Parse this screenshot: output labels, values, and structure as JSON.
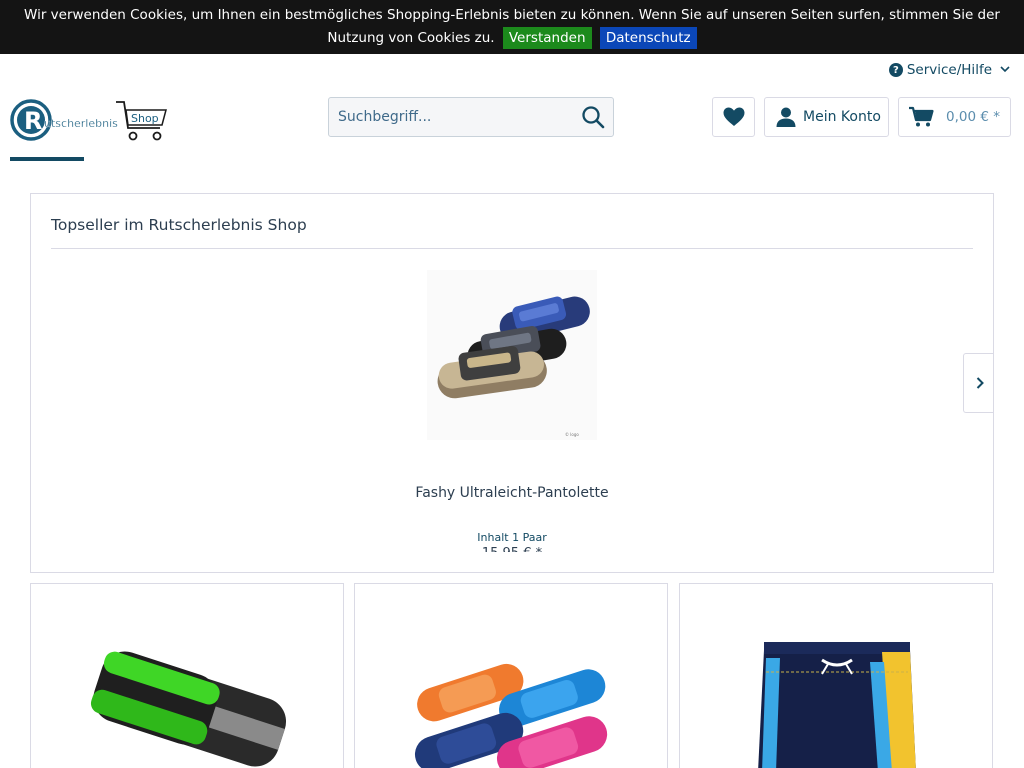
{
  "cookie_bar": {
    "message": "Wir verwenden Cookies, um Ihnen ein bestmögliches Shopping-Erlebnis bieten zu können. Wenn Sie auf unseren Seiten surfen, stimmen Sie der Nutzung von Cookies zu.",
    "accept_label": "Verstanden",
    "privacy_label": "Datenschutz",
    "accept_color": "#1c8a1c",
    "privacy_color": "#0b47b8"
  },
  "header": {
    "service_label": "Service/Hilfe",
    "logo_letter": "R",
    "logo_text": "utscherlebnis",
    "logo_shop": "Shop",
    "search_placeholder": "Suchbegriff...",
    "account_label": "Mein Konto",
    "cart_total": "0,00 € *",
    "brand_color": "#134a63"
  },
  "topseller": {
    "title": "Topseller im Rutscherlebnis Shop",
    "product_name": "Fashy Ultraleicht-Pantolette",
    "unit": "Inhalt 1 Paar",
    "price": "15,95 € *"
  },
  "icons": {
    "service": "question-circle-icon",
    "wishlist": "heart-icon",
    "account": "user-icon",
    "cart": "cart-icon",
    "search": "magnifier-icon",
    "next": "chevron-right-icon"
  }
}
